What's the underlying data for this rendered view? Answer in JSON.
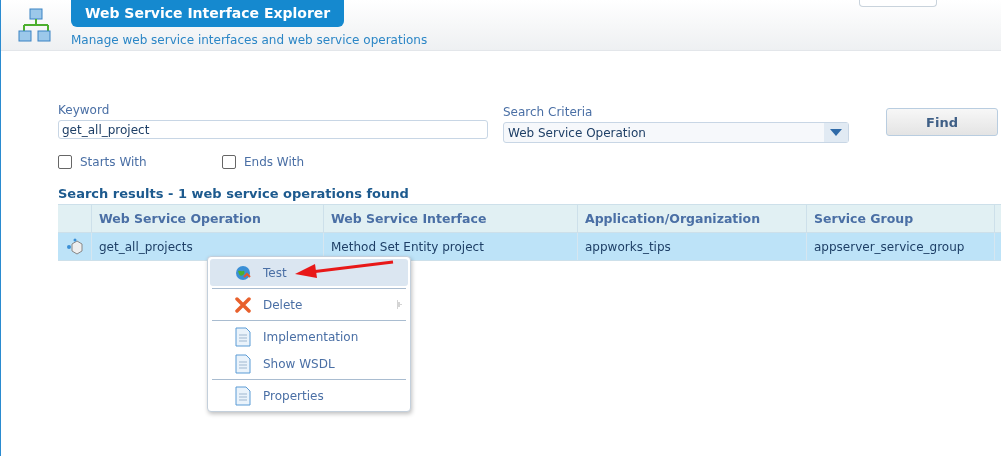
{
  "header": {
    "title": "Web Service Interface Explorer",
    "subtitle": "Manage web service interfaces and web service operations"
  },
  "search": {
    "keyword_label": "Keyword",
    "keyword_value": "get_all_project",
    "criteria_label": "Search Criteria",
    "criteria_value": "Web Service Operation",
    "find_button": "Find",
    "options": [
      {
        "label": "Starts With",
        "checked": false
      },
      {
        "label": "Ends With",
        "checked": false
      }
    ]
  },
  "results": {
    "summary": "Search results - 1 web service operations found",
    "columns": [
      "Web Service Operation",
      "Web Service Interface",
      "Application/Organization",
      "Service Group"
    ],
    "rows": [
      {
        "selected": true,
        "cells": [
          "get_all_projects",
          "Method Set Entity project",
          "appworks_tips",
          "appserver_service_group"
        ]
      }
    ]
  },
  "context_menu": {
    "items": [
      {
        "kind": "test",
        "label": "Test",
        "selected": true,
        "submenu": false
      },
      {
        "kind": "separator"
      },
      {
        "kind": "delete",
        "label": "Delete",
        "selected": false,
        "submenu": true
      },
      {
        "kind": "separator"
      },
      {
        "kind": "document",
        "label": "Implementation",
        "selected": false,
        "submenu": false
      },
      {
        "kind": "document",
        "label": "Show WSDL",
        "selected": false,
        "submenu": false
      },
      {
        "kind": "separator"
      },
      {
        "kind": "document",
        "label": "Properties",
        "selected": false,
        "submenu": false
      }
    ]
  }
}
